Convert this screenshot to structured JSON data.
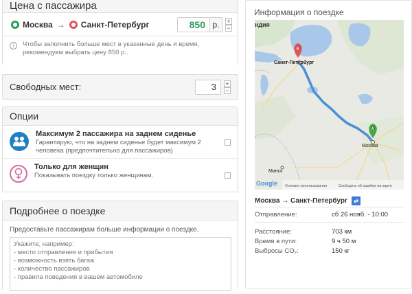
{
  "price_panel": {
    "title": "Цена с пассажира",
    "from": "Москва",
    "arrow": "→",
    "to": "Санкт-Петербург",
    "price": "850",
    "currency": "р.",
    "hint": "Чтобы заполнить больше мест в указанные день и время, рекомендуем выбрать цену 850 р.."
  },
  "seats": {
    "label": "Свободных мест:",
    "value": "3"
  },
  "options": {
    "title": "Опции",
    "items": [
      {
        "title": "Максимум 2 пассажира на заднем сиденье",
        "desc": "Гарантирую, что на заднем сиденье будет максимум 2 человека (предпочтительно для пассажиров)"
      },
      {
        "title": "Только для женщин",
        "desc": "Показывать поездку только женщинам."
      }
    ]
  },
  "details": {
    "title": "Подробнее о поездке",
    "label": "Предоставьте пассажирам больше информации о поездке.",
    "placeholder": "Укажите, например:\n- место отправления и прибытия\n- возможность взять багаж\n- количество пассажиров\n- правила поведения в вашем автомобиле"
  },
  "info": {
    "title": "Информация о поездке",
    "map": {
      "city_top": "ндия",
      "spb": "Санкт-Петербург",
      "moscow": "Москва",
      "minsk": "Минск",
      "marker_a": "A",
      "marker_b": "B",
      "google": "Google",
      "terms": "Условия использования",
      "report": "Сообщить об ошибке на карте"
    },
    "route": "Москва → Санкт-Петербург",
    "departure_label": "Отправление:",
    "departure_value": "сб 26 нояб. - 10:00",
    "distance_label": "Расстояние:",
    "distance_value": "703 км",
    "duration_label": "Время в пути:",
    "duration_value": "9 ч 50 м",
    "co2_label": "Выбросы CO₂:",
    "co2_value": "150 кг"
  },
  "colors": {
    "accent_green": "#2d9c5a",
    "accent_red": "#e0535f",
    "route_blue": "#4a8fd6"
  }
}
